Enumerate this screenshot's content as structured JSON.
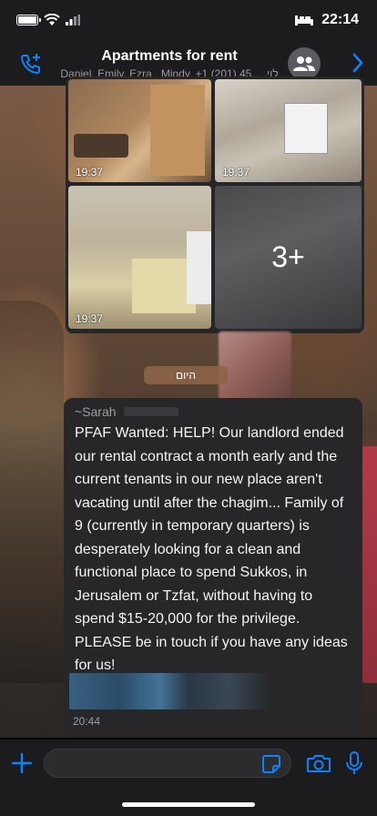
{
  "status_bar": {
    "time": "22:14",
    "icons": [
      "battery-icon",
      "wifi-icon",
      "signal-icon",
      "bed-icon"
    ]
  },
  "header": {
    "title": "Apartments for rent",
    "subtitle": "Daniel, Emily, Ezra , Mindy, +1 (201) 45... ,לוי",
    "icons": [
      "add-call-icon",
      "group-avatar-icon",
      "chevron-right-icon"
    ]
  },
  "media_grid": {
    "tiles": [
      {
        "time": "19:37"
      },
      {
        "time": "19:37"
      },
      {
        "time": "19:37"
      },
      {
        "more": "3+"
      }
    ]
  },
  "date_chip": "היום",
  "message": {
    "sender": "~Sarah",
    "text": "PFAF Wanted: HELP! Our landlord ended our rental contract a month early and the current tenants in our new place aren't vacating until after the chagim... Family of 9 (currently in temporary quarters) is desperately looking for a clean and functional place to spend Sukkos, in Jerusalem or Tzfat, without having to spend $15-20,000 for the privilege. PLEASE be in touch if you have any ideas for us!",
    "time": "20:44"
  },
  "input_bar": {
    "placeholder": "",
    "icons": [
      "plus-icon",
      "sticker-icon",
      "camera-icon",
      "microphone-icon"
    ]
  },
  "colors": {
    "accent": "#0a84ff",
    "bar_bg": "#1c1c1e",
    "bubble_bg": "#27272a"
  }
}
